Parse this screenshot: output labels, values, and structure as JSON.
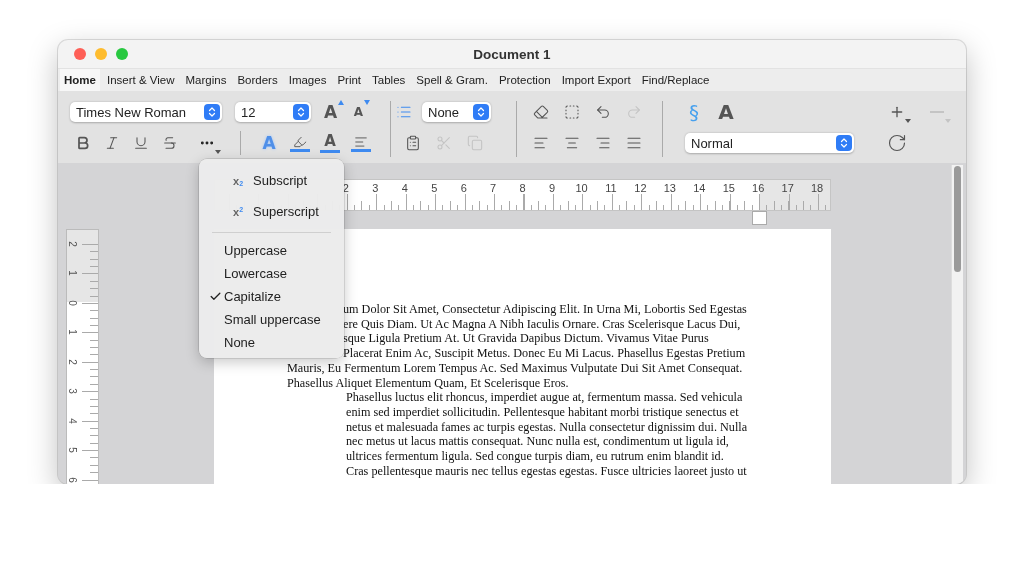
{
  "window": {
    "title": "Document 1"
  },
  "tabs": [
    {
      "label": "Home",
      "selected": true
    },
    {
      "label": "Insert & View",
      "selected": false
    },
    {
      "label": "Margins",
      "selected": false
    },
    {
      "label": "Borders",
      "selected": false
    },
    {
      "label": "Images",
      "selected": false
    },
    {
      "label": "Print",
      "selected": false
    },
    {
      "label": "Tables",
      "selected": false
    },
    {
      "label": "Spell & Gram.",
      "selected": false
    },
    {
      "label": "Protection",
      "selected": false
    },
    {
      "label": "Import Export",
      "selected": false
    },
    {
      "label": "Find/Replace",
      "selected": false
    }
  ],
  "toolbar": {
    "font": "Times New Roman",
    "size": "12",
    "grow_glyph": "A",
    "shrink_glyph": "A",
    "effect_glyph": "A",
    "color_glyph": "A",
    "list_style": "None",
    "section_glyph": "§",
    "style_glyph": "A",
    "paragraph_style": "Normal",
    "edit_buttons": [
      {
        "kind": "paste",
        "disabled": false
      },
      {
        "kind": "cut",
        "disabled": true
      },
      {
        "kind": "copy",
        "disabled": true
      }
    ],
    "history_buttons": [
      {
        "kind": "eraser",
        "disabled": false
      },
      {
        "kind": "select",
        "disabled": false
      },
      {
        "kind": "undo",
        "disabled": false
      },
      {
        "kind": "redo",
        "disabled": true
      }
    ],
    "side_buttons": [
      {
        "kind": "add",
        "disabled": false
      },
      {
        "kind": "remove",
        "disabled": true
      }
    ]
  },
  "menu": {
    "items": [
      {
        "kind": "subscript",
        "glyph": "x",
        "index": "2",
        "label": "Subscript"
      },
      {
        "kind": "superscript",
        "glyph": "x",
        "index": "2",
        "label": "Superscript"
      },
      {
        "kind": "separator"
      },
      {
        "kind": "case",
        "label": "Uppercase",
        "selected": false
      },
      {
        "kind": "case",
        "label": "Lowercase",
        "selected": false
      },
      {
        "kind": "case",
        "label": "Capitalize",
        "selected": true
      },
      {
        "kind": "case",
        "label": "Small uppercase",
        "selected": false
      },
      {
        "kind": "case",
        "label": "None",
        "selected": false
      }
    ]
  },
  "horizontal_ruler": [
    "2",
    "3",
    "4",
    "5",
    "6",
    "7",
    "8",
    "9",
    "10",
    "11",
    "12",
    "13",
    "14",
    "15",
    "16",
    "17",
    "18"
  ],
  "vertical_ruler": [
    "2",
    "1",
    "0",
    "1",
    "2",
    "3",
    "4",
    "5",
    "6"
  ],
  "document": {
    "paragraphs": [
      {
        "kind": "covered",
        "lines": [
          "um Dolor Sit Amet, Consectetur Adipiscing Elit. In Urna Mi, Lobortis Sed Egestas",
          "ere Quis Diam. Ut Ac Magna A Nibh Iaculis Ornare. Cras Scelerisque Lacus Dui,",
          "sque Ligula Pretium At. Ut Gravida Dapibus Dictum. Vivamus Vitae Purus",
          "Placerat Enim Ac, Suscipit Metus. Donec Eu Mi Lacus. Phasellus Egestas Pretium"
        ]
      },
      {
        "kind": "body",
        "lines": [
          "Mauris, Eu Fermentum Lorem Tempus Ac. Sed Maximus Vulputate Dui Sit Amet Consequat.",
          "Phasellus Aliquet Elementum Quam, Et Scelerisque Eros."
        ]
      },
      {
        "kind": "indented",
        "lines": [
          "Phasellus luctus elit rhoncus, imperdiet augue at, fermentum massa. Sed vehicula",
          "enim sed imperdiet sollicitudin. Pellentesque habitant morbi tristique senectus et",
          "netus et malesuada fames ac turpis egestas. Nulla consectetur dignissim dui. Nulla",
          "nec metus ut lacus mattis consequat. Nunc nulla est, condimentum ut ligula id,",
          "ultrices fermentum ligula. Sed congue turpis diam, eu rutrum enim blandit id.",
          "Cras pellentesque mauris nec tellus egestas egestas. Fusce ultricies laoreet justo ut"
        ]
      }
    ]
  }
}
